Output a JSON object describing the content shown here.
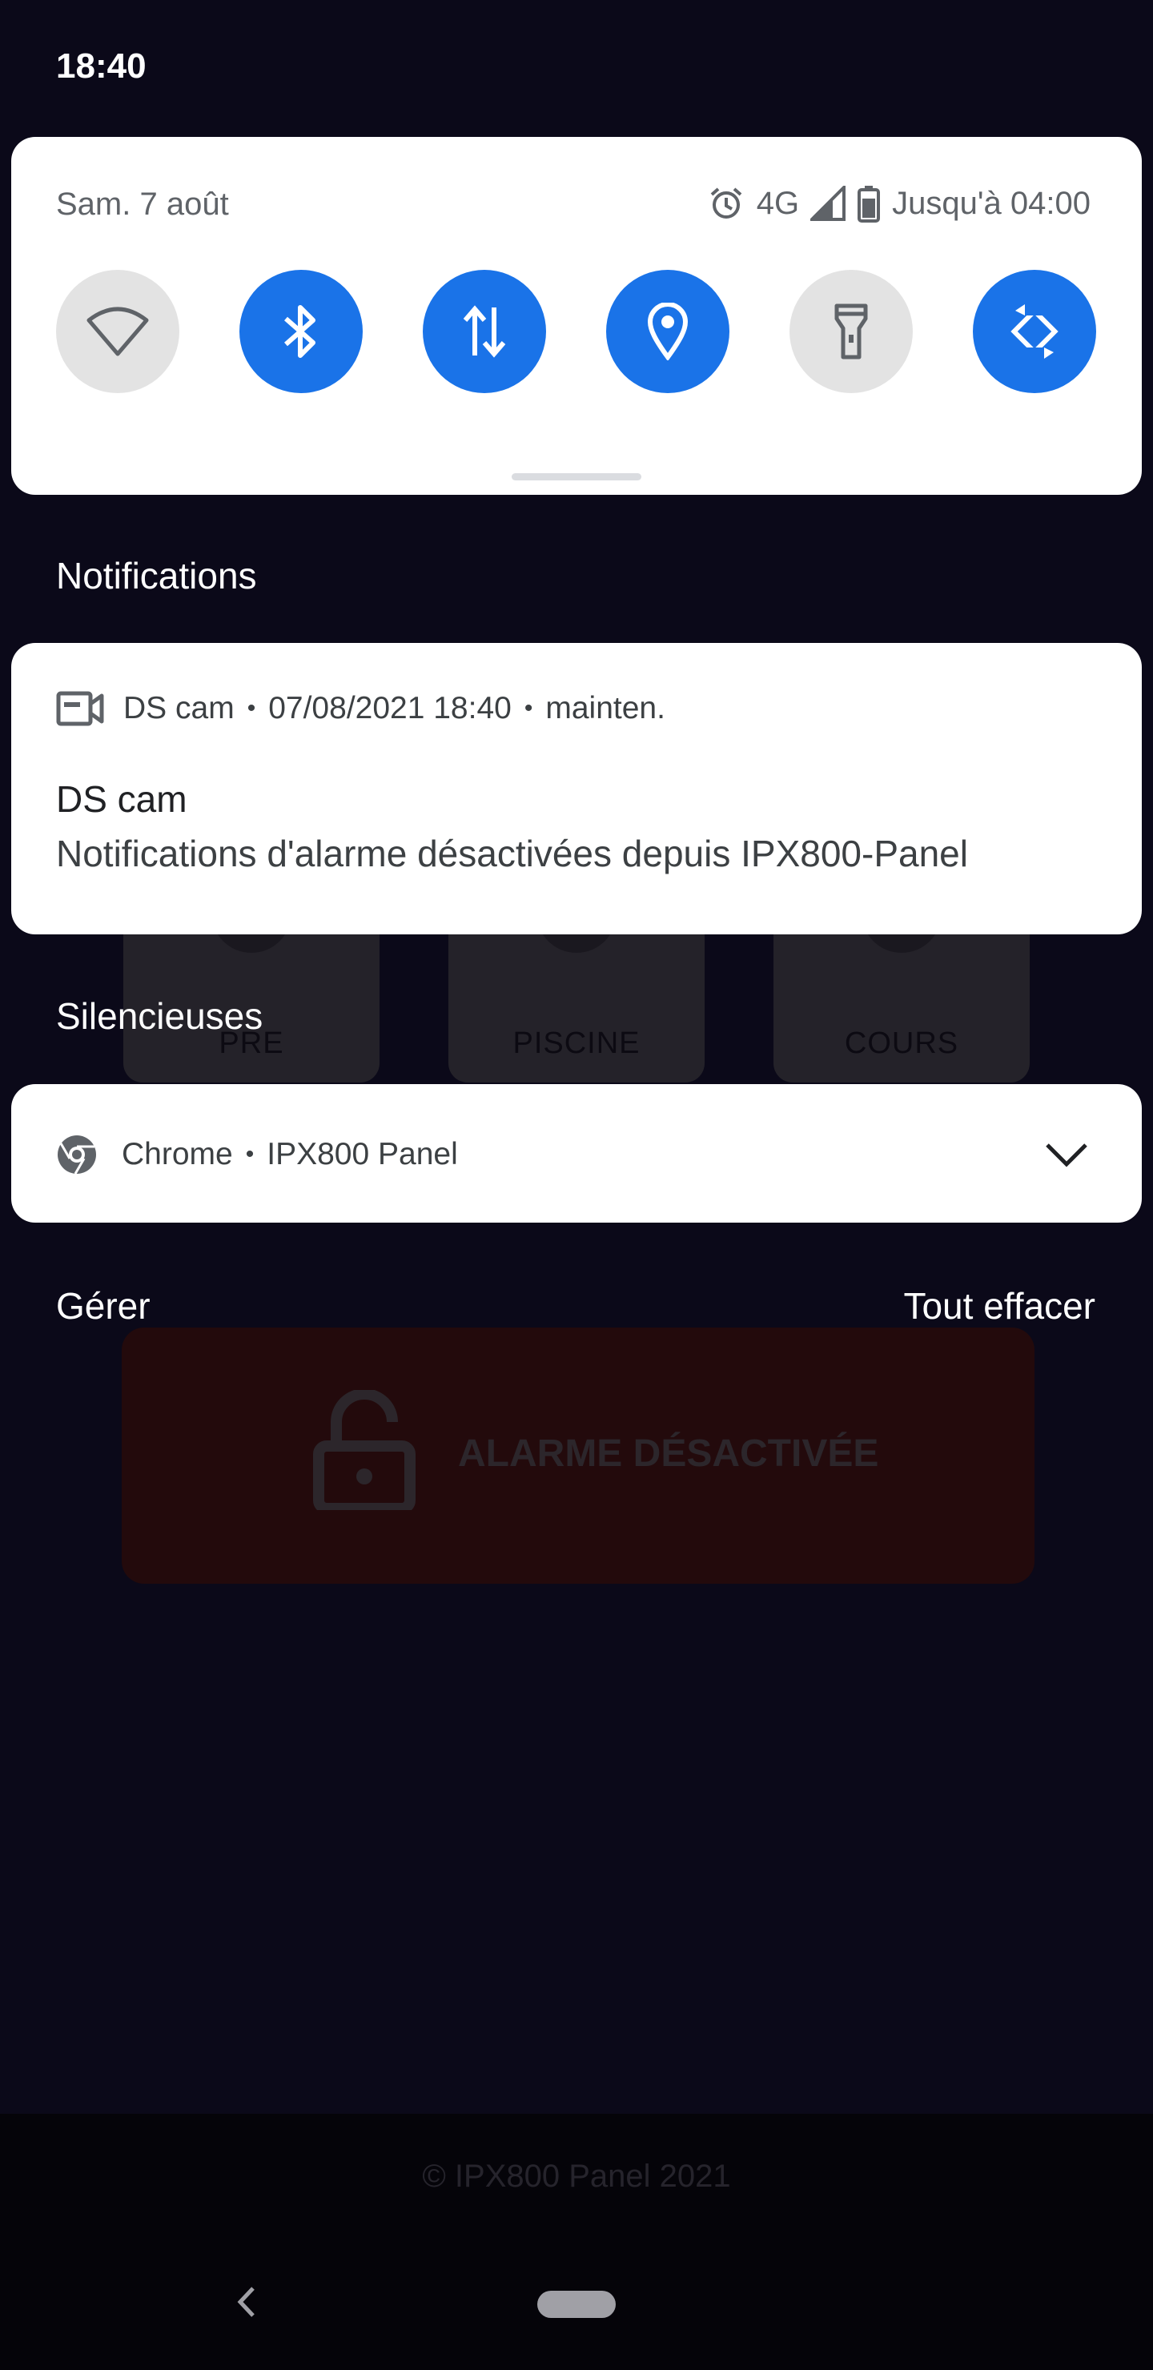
{
  "status_bar": {
    "time": "18:40"
  },
  "quick_settings": {
    "date": "Sam. 7 août",
    "network": "4G",
    "battery_text": "Jusqu'à 04:00",
    "tiles": [
      {
        "name": "wifi",
        "state": "off"
      },
      {
        "name": "bluetooth",
        "state": "on"
      },
      {
        "name": "mobile-data",
        "state": "on"
      },
      {
        "name": "location",
        "state": "on"
      },
      {
        "name": "flashlight",
        "state": "off"
      },
      {
        "name": "auto-rotate",
        "state": "on"
      }
    ],
    "colors": {
      "tile_on": "#1a73e8",
      "tile_off": "#e3e3e3"
    }
  },
  "notifications": {
    "heading": "Notifications",
    "items": [
      {
        "app": "DS cam",
        "time": "07/08/2021 18:40",
        "when": "mainten.",
        "title": "DS cam",
        "body": "Notifications d'alarme désactivées depuis IPX800-Panel"
      }
    ]
  },
  "silent": {
    "heading": "Silencieuses",
    "items": [
      {
        "app": "Chrome",
        "site": "IPX800 Panel"
      }
    ]
  },
  "actions": {
    "manage": "Gérer",
    "clear_all": "Tout effacer"
  },
  "background_app": {
    "tiles": [
      "PRE",
      "PISCINE",
      "COURS"
    ],
    "alarm_status": "ALARME DÉSACTIVÉE",
    "footer": "© IPX800 Panel 2021"
  }
}
